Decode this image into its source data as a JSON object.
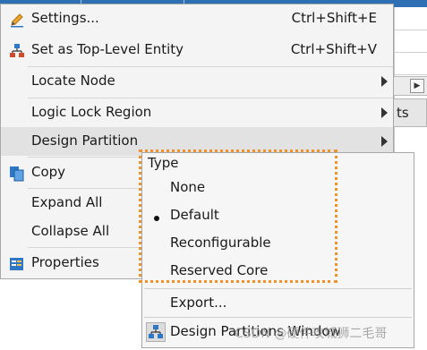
{
  "context_menu": {
    "items": [
      {
        "label": "Settings...",
        "accel": "Ctrl+Shift+E",
        "icon": "settings-pencil-icon"
      },
      {
        "label": "Set as Top-Level Entity",
        "accel": "Ctrl+Shift+V",
        "icon": "hierarchy-icon"
      },
      {
        "label": "Locate Node",
        "has_submenu": true
      },
      {
        "label": "Logic Lock Region",
        "has_submenu": true
      },
      {
        "label": "Design Partition",
        "has_submenu": true
      },
      {
        "label": "Copy",
        "icon": "copy-icon"
      },
      {
        "label": "Expand All"
      },
      {
        "label": "Collapse All"
      },
      {
        "label": "Properties",
        "icon": "properties-icon"
      }
    ]
  },
  "design_partition_submenu": {
    "type_label": "Type",
    "type_options": [
      {
        "label": "None",
        "selected": false
      },
      {
        "label": "Default",
        "selected": true
      },
      {
        "label": "Reconfigurable",
        "selected": false
      },
      {
        "label": "Reserved Core",
        "selected": false
      }
    ],
    "export_label": "Export...",
    "window_label": "Design Partitions Window",
    "window_icon": "partitions-window-icon"
  },
  "background": {
    "button_text": "ts"
  },
  "watermark": "CSDN @硬件攻城狮二毛哥",
  "colors": {
    "highlight_box": "#f0922a",
    "menu_bg": "#f4f4f4",
    "icon_blue": "#2f78c8"
  }
}
